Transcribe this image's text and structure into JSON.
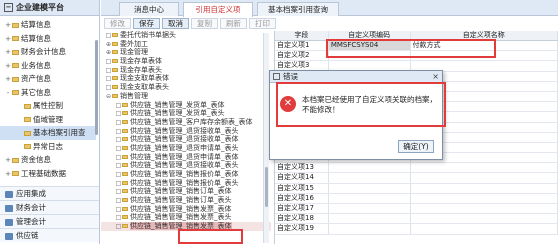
{
  "app": {
    "title": "企业建模平台"
  },
  "nav": {
    "items": [
      {
        "label": "结算信息",
        "toggle": "+"
      },
      {
        "label": "结算信息",
        "toggle": "+"
      },
      {
        "label": "财务会计信息",
        "toggle": "+"
      },
      {
        "label": "业务信息",
        "toggle": "+"
      },
      {
        "label": "资产信息",
        "toggle": "+"
      },
      {
        "label": "其它信息",
        "toggle": "-"
      },
      {
        "label": "属性控制",
        "toggle": ""
      },
      {
        "label": "值域管理",
        "toggle": ""
      },
      {
        "label": "基本档案引用查",
        "toggle": ""
      },
      {
        "label": "异常日志",
        "toggle": ""
      },
      {
        "label": "资金信息",
        "toggle": "+"
      },
      {
        "label": "工程基础数据",
        "toggle": "+"
      }
    ],
    "bottom": [
      "应用集成",
      "财务会计",
      "管理会计",
      "供应链"
    ]
  },
  "tabs": [
    {
      "label": "消息中心"
    },
    {
      "label": "引用自定义项"
    },
    {
      "label": "基本档案引用查询"
    }
  ],
  "toolbar": {
    "buttons": [
      "修改",
      "保存",
      "取消",
      "复制",
      "刷新",
      "打印"
    ]
  },
  "tree": {
    "items": [
      {
        "label": "委托代销书单据头",
        "prefix": "□"
      },
      {
        "label": "委外加工",
        "prefix": "⊕"
      },
      {
        "label": "现金管理",
        "prefix": "⊕"
      },
      {
        "label": "现金存单表体",
        "prefix": "□"
      },
      {
        "label": "现金存单表头",
        "prefix": "□"
      },
      {
        "label": "现金支取单表体",
        "prefix": "□"
      },
      {
        "label": "现金支取单表头",
        "prefix": "□"
      },
      {
        "label": "销售管理",
        "prefix": "⊖"
      },
      {
        "label": "供应链_销售管理_发货单_表体",
        "prefix": "□"
      },
      {
        "label": "供应链_销售管理_发货单_表头",
        "prefix": "□"
      },
      {
        "label": "供应链_销售管理_客户库存余额表_表体",
        "prefix": "□"
      },
      {
        "label": "供应链_销售管理_退货接收单_表头",
        "prefix": "□"
      },
      {
        "label": "供应链_销售管理_退货接收单_表体",
        "prefix": "□"
      },
      {
        "label": "供应链_销售管理_退货申请单_表头",
        "prefix": "□"
      },
      {
        "label": "供应链_销售管理_退货申请单_表体",
        "prefix": "□"
      },
      {
        "label": "供应链_销售管理_退货接收单_表头",
        "prefix": "□"
      },
      {
        "label": "供应链_销售管理_销售报价单_表体",
        "prefix": "□"
      },
      {
        "label": "供应链_销售管理_销售报价单_表头",
        "prefix": "□"
      },
      {
        "label": "供应链_销售管理_销售订单_表体",
        "prefix": "□"
      },
      {
        "label": "供应链_销售管理_销售订单_表头",
        "prefix": "□"
      },
      {
        "label": "供应链_销售管理_销售发票_表体",
        "prefix": "□"
      },
      {
        "label": "供应链_销售管理_销售发票_表头",
        "prefix": "□"
      },
      {
        "label": "供应链_销售管理_销售发票_表体",
        "prefix": "□",
        "selected": true,
        "select_part": "销售发票_表体"
      }
    ]
  },
  "grid": {
    "headers": [
      "字段",
      "自定义项编码",
      "自定义项名称"
    ],
    "rows": [
      [
        "自定义项1",
        "MMSFCSYS04",
        "付款方式"
      ],
      [
        "自定义项2",
        "",
        ""
      ],
      [
        "自定义项3",
        "",
        ""
      ],
      [
        "自定义项4",
        "",
        ""
      ],
      [
        "自定义项5",
        "",
        ""
      ],
      [
        "自定义项6",
        "",
        ""
      ],
      [
        "自定义项7",
        "",
        ""
      ],
      [
        "自定义项8",
        "",
        ""
      ],
      [
        "自定义项9",
        "",
        ""
      ],
      [
        "自定义项10",
        "",
        ""
      ],
      [
        "自定义项11",
        "",
        ""
      ],
      [
        "自定义项12",
        "",
        ""
      ],
      [
        "自定义项13",
        "",
        ""
      ],
      [
        "自定义项14",
        "",
        ""
      ],
      [
        "自定义项15",
        "",
        ""
      ],
      [
        "自定义项16",
        "",
        ""
      ],
      [
        "自定义项17",
        "",
        ""
      ],
      [
        "自定义项18",
        "",
        ""
      ],
      [
        "自定义项19",
        "",
        ""
      ]
    ]
  },
  "dialog": {
    "title": "错误",
    "close": "×",
    "icon": "✕",
    "message": "本档案已经使用了自定义项关联的档案，不能修改！",
    "ok_label": "确定(Y)"
  },
  "colors": {
    "highlight": "#e23b3b",
    "header_bg": "#dfe9f5"
  }
}
